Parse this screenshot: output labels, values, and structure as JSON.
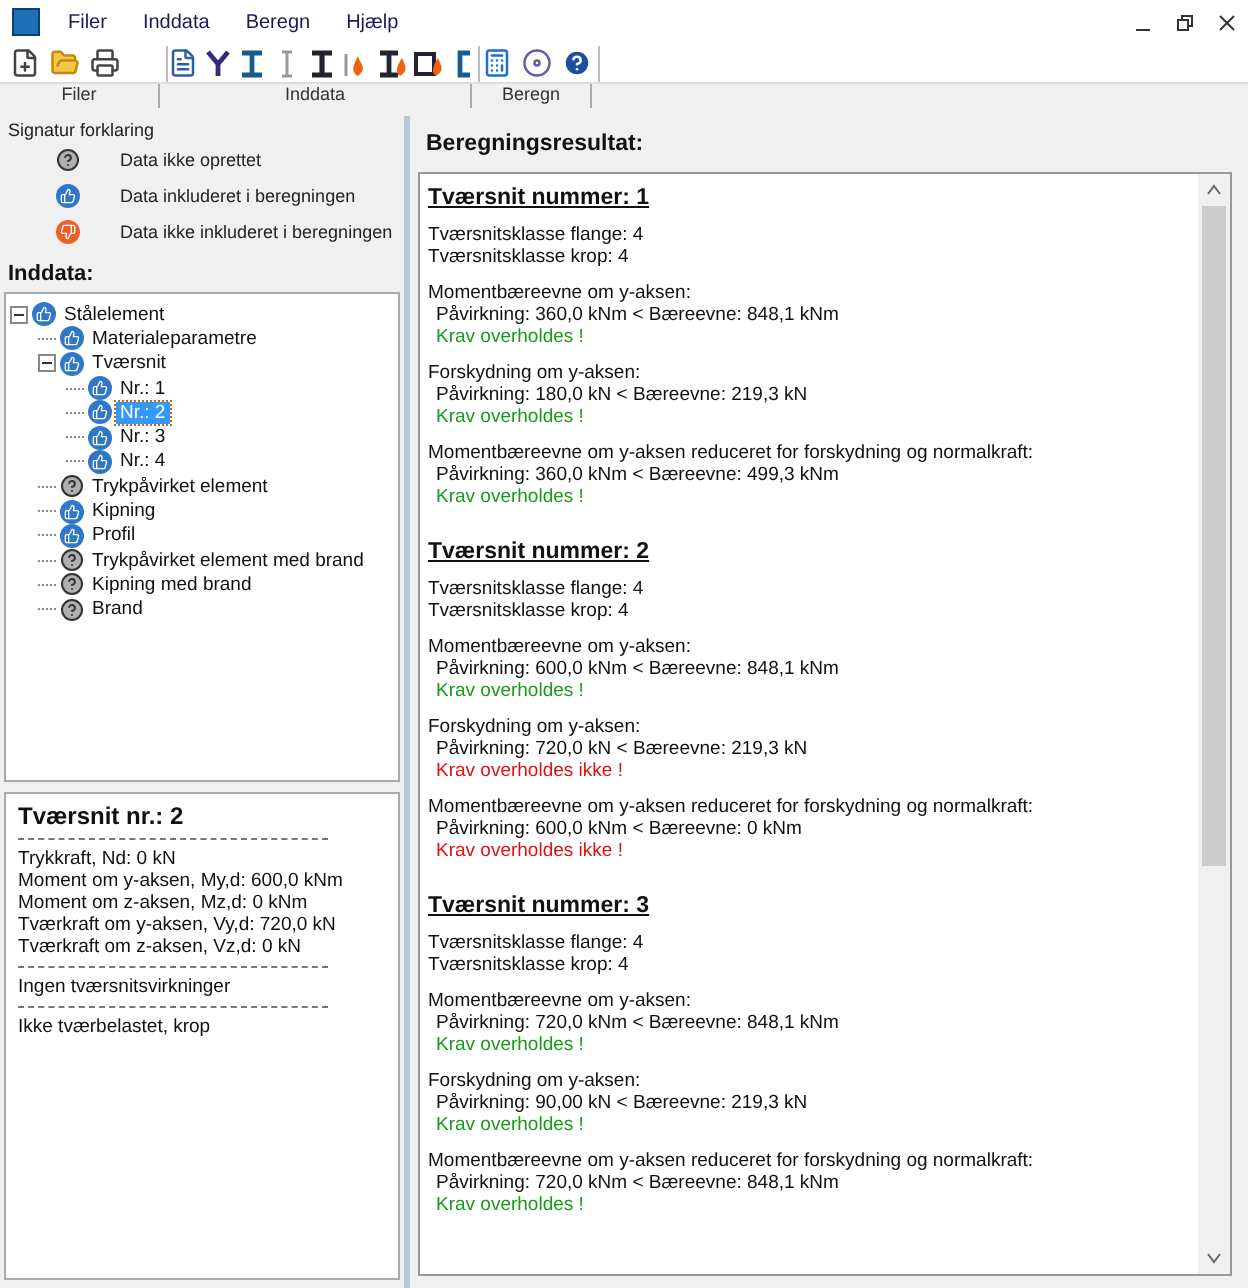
{
  "menu": [
    "Filer",
    "Inddata",
    "Beregn",
    "Hjælp"
  ],
  "toolbar_groups": [
    {
      "label": "Filer",
      "tools": [
        {
          "kind": "new"
        },
        {
          "kind": "open"
        },
        {
          "kind": "print"
        }
      ]
    },
    {
      "label": "Inddata",
      "tools": [
        {
          "kind": "doc"
        },
        {
          "kind": "y-profile"
        },
        {
          "kind": "i-beam"
        },
        {
          "kind": "column"
        },
        {
          "kind": "beam"
        },
        {
          "kind": "fire-column"
        },
        {
          "kind": "fire-beam"
        },
        {
          "kind": "fire-box"
        },
        {
          "kind": "channel"
        }
      ]
    },
    {
      "label": "Beregn",
      "tools": [
        {
          "kind": "calculator"
        },
        {
          "kind": "disc"
        },
        {
          "kind": "help"
        }
      ]
    }
  ],
  "legend": {
    "title": "Signatur forklaring",
    "items": [
      {
        "kind": "missing",
        "label": "Data ikke oprettet"
      },
      {
        "kind": "included",
        "label": "Data inkluderet i beregningen"
      },
      {
        "kind": "excluded",
        "label": "Data ikke inkluderet i beregningen"
      }
    ]
  },
  "tree": {
    "title": "Inddata:",
    "nodes": [
      {
        "label": "Stålelement",
        "kind": "included",
        "selected": false,
        "expanded": true,
        "children": [
          {
            "label": "Materialeparametre",
            "kind": "included",
            "selected": false
          },
          {
            "label": "Tværsnit",
            "kind": "included",
            "selected": false,
            "expanded": true,
            "children": [
              {
                "label": "Nr.: 1",
                "kind": "included",
                "selected": false
              },
              {
                "label": "Nr.: 2",
                "kind": "included",
                "selected": true
              },
              {
                "label": "Nr.: 3",
                "kind": "included",
                "selected": false
              },
              {
                "label": "Nr.: 4",
                "kind": "included",
                "selected": false
              }
            ]
          },
          {
            "label": "Trykpåvirket element",
            "kind": "missing",
            "selected": false
          },
          {
            "label": "Kipning",
            "kind": "included",
            "selected": false
          },
          {
            "label": "Profil",
            "kind": "included",
            "selected": false
          },
          {
            "label": "Trykpåvirket element med brand",
            "kind": "missing",
            "selected": false
          },
          {
            "label": "Kipning med brand",
            "kind": "missing",
            "selected": false
          },
          {
            "label": "Brand",
            "kind": "missing",
            "selected": false
          }
        ]
      }
    ]
  },
  "details": {
    "title": "Tværsnit nr.: 2",
    "groups": [
      [
        "Trykkraft, Nd: 0 kN",
        "Moment om y-aksen, My,d: 600,0 kNm",
        "Moment om z-aksen, Mz,d: 0 kNm",
        "Tværkraft om y-aksen, Vy,d: 720,0 kN",
        "Tværkraft om z-aksen, Vz,d: 0 kN"
      ],
      [
        "Ingen tværsnitsvirkninger"
      ],
      [
        "Ikke tværbelastet, krop"
      ]
    ]
  },
  "results": {
    "title": "Beregningsresultat:",
    "sections": [
      {
        "title": "Tværsnit nummer: 1",
        "classes": [
          "Tværsnitsklasse flange: 4",
          "Tværsnitsklasse krop: 4"
        ],
        "checks": [
          {
            "heading": "Momentbæreevne om y-aksen:",
            "line": "Påvirkning: 360,0 kNm < Bæreevne: 848,1 kNm",
            "verdict": "Krav overholdes !",
            "ok": true
          },
          {
            "heading": "Forskydning om y-aksen:",
            "line": "Påvirkning: 180,0 kN < Bæreevne: 219,3 kN",
            "verdict": "Krav overholdes !",
            "ok": true
          },
          {
            "heading": "Momentbæreevne om y-aksen reduceret for forskydning og normalkraft:",
            "line": "Påvirkning: 360,0 kNm < Bæreevne: 499,3 kNm",
            "verdict": "Krav overholdes !",
            "ok": true
          }
        ]
      },
      {
        "title": "Tværsnit nummer: 2",
        "classes": [
          "Tværsnitsklasse flange: 4",
          "Tværsnitsklasse krop: 4"
        ],
        "checks": [
          {
            "heading": "Momentbæreevne om y-aksen:",
            "line": "Påvirkning: 600,0 kNm < Bæreevne: 848,1 kNm",
            "verdict": "Krav overholdes !",
            "ok": true
          },
          {
            "heading": "Forskydning om y-aksen:",
            "line": "Påvirkning: 720,0 kN < Bæreevne: 219,3 kN",
            "verdict": "Krav overholdes ikke !",
            "ok": false
          },
          {
            "heading": "Momentbæreevne om y-aksen reduceret for forskydning og normalkraft:",
            "line": "Påvirkning: 600,0 kNm < Bæreevne: 0 kNm",
            "verdict": "Krav overholdes ikke !",
            "ok": false
          }
        ]
      },
      {
        "title": "Tværsnit nummer: 3",
        "classes": [
          "Tværsnitsklasse flange: 4",
          "Tværsnitsklasse krop: 4"
        ],
        "checks": [
          {
            "heading": "Momentbæreevne om y-aksen:",
            "line": "Påvirkning: 720,0 kNm < Bæreevne: 848,1 kNm",
            "verdict": "Krav overholdes !",
            "ok": true
          },
          {
            "heading": "Forskydning om y-aksen:",
            "line": "Påvirkning: 90,00 kN < Bæreevne: 219,3 kN",
            "verdict": "Krav overholdes !",
            "ok": true
          },
          {
            "heading": "Momentbæreevne om y-aksen reduceret for forskydning og normalkraft:",
            "line": "Påvirkning: 720,0 kNm < Bæreevne: 848,1 kNm",
            "verdict": "Krav overholdes !",
            "ok": true
          }
        ]
      }
    ]
  }
}
